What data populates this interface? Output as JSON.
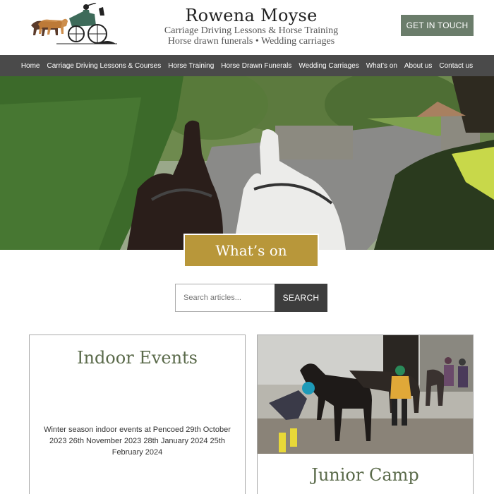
{
  "header": {
    "title": "Rowena Moyse",
    "subtitle_line1": "Carriage Driving Lessons & Horse Training",
    "subtitle_line2": "Horse drawn funerals • Wedding carriages",
    "cta_label": "GET IN TOUCH"
  },
  "nav": {
    "items": [
      {
        "label": "Home"
      },
      {
        "label": "Carriage Driving Lessons & Courses"
      },
      {
        "label": "Horse Training"
      },
      {
        "label": "Horse Drawn Funerals"
      },
      {
        "label": "Wedding Carriages"
      },
      {
        "label": "What's on"
      },
      {
        "label": "About us"
      },
      {
        "label": "Contact us"
      }
    ]
  },
  "page": {
    "title": "What’s on"
  },
  "search": {
    "placeholder": "Search articles...",
    "button_label": "SEARCH"
  },
  "cards": [
    {
      "title": "Indoor Events",
      "text": "Winter season indoor events at Pencoed 29th October 2023  26th November 2023   28th January 2024  25th February 2024"
    },
    {
      "title": "Junior Camp"
    }
  ],
  "colors": {
    "nav_bg": "#4a4a4a",
    "cta_bg": "#6b7d6b",
    "accent_gold": "#b8973a",
    "card_title": "#5a6a4a"
  }
}
